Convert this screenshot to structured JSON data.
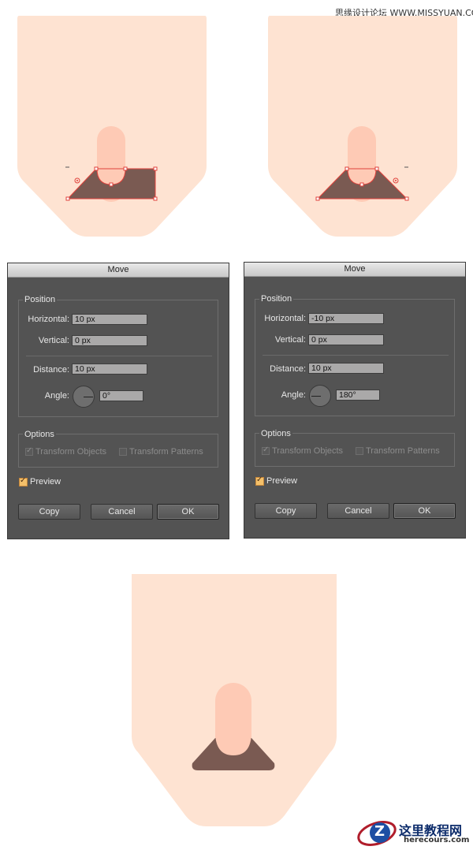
{
  "watermark": {
    "top_text": "思缘设计论坛  WWW.MISSYUAN.COM",
    "logo_cn": "这里教程网",
    "logo_en": "herecours.com",
    "logo_letter": "Z"
  },
  "dialogs": [
    {
      "title": "Move",
      "position_label": "Position",
      "horizontal_label": "Horizontal:",
      "horizontal_value": "10 px",
      "vertical_label": "Vertical:",
      "vertical_value": "0 px",
      "distance_label": "Distance:",
      "distance_value": "10 px",
      "angle_label": "Angle:",
      "angle_value": "0°",
      "options_label": "Options",
      "transform_objects": "Transform Objects",
      "transform_patterns": "Transform Patterns",
      "preview": "Preview",
      "copy": "Copy",
      "cancel": "Cancel",
      "ok": "OK"
    },
    {
      "title": "Move",
      "position_label": "Position",
      "horizontal_label": "Horizontal:",
      "horizontal_value": "-10 px",
      "vertical_label": "Vertical:",
      "vertical_value": "0 px",
      "distance_label": "Distance:",
      "distance_value": "10 px",
      "angle_label": "Angle:",
      "angle_value": "180°",
      "options_label": "Options",
      "transform_objects": "Transform Objects",
      "transform_patterns": "Transform Patterns",
      "preview": "Preview",
      "copy": "Copy",
      "cancel": "Cancel",
      "ok": "OK"
    }
  ],
  "colors": {
    "skin": "#fee3d2",
    "finger": "#fecab5",
    "nail_shape": "#7a5a52",
    "selection": "#e0423c",
    "dialog_bg": "#535353"
  }
}
